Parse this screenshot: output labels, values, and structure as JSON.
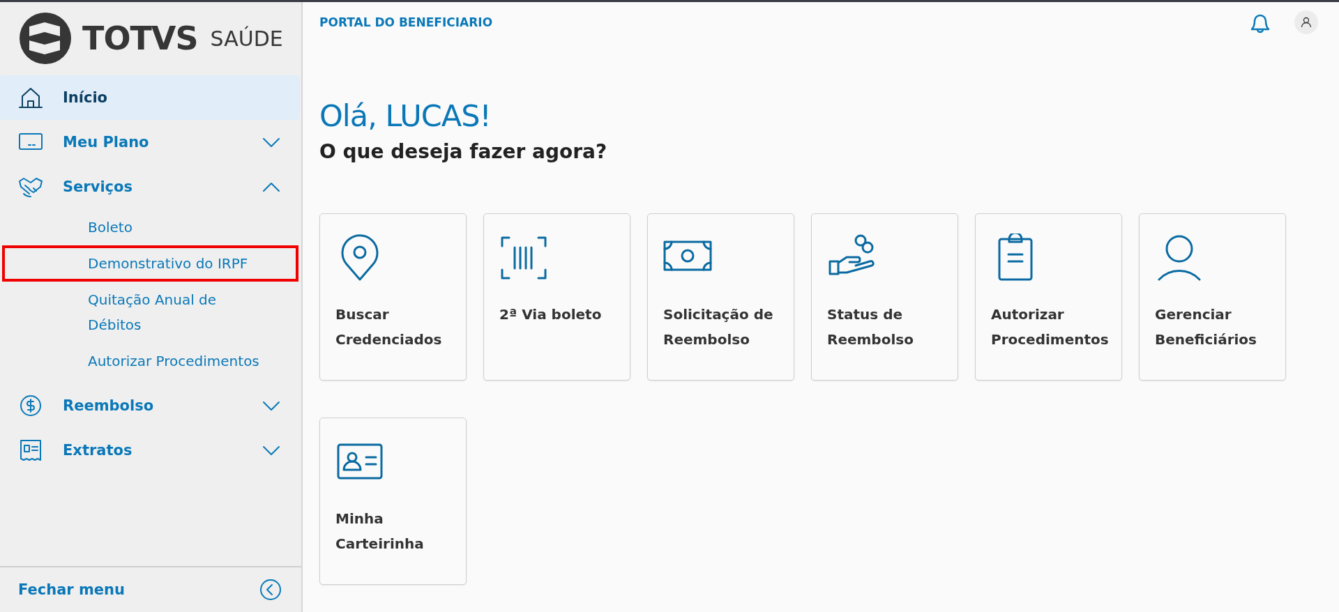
{
  "sidebar": {
    "logo": {
      "brand": "TOTVS",
      "product": "SAÚDE"
    },
    "items": [
      {
        "label": "Início",
        "selected": true
      },
      {
        "label": "Meu Plano",
        "expanded": false
      },
      {
        "label": "Serviços",
        "expanded": true,
        "children": [
          {
            "label": "Boleto",
            "highlighted": false
          },
          {
            "label": "Demonstrativo do IRPF",
            "highlighted": true
          },
          {
            "label": "Quitação Anual de Débitos",
            "highlighted": false
          },
          {
            "label": "Autorizar Procedimentos",
            "highlighted": false
          }
        ]
      },
      {
        "label": "Reembolso",
        "expanded": false
      },
      {
        "label": "Extratos",
        "expanded": false
      }
    ],
    "footer": "Fechar menu"
  },
  "header": {
    "title": "PORTAL DO BENEFICIARIO"
  },
  "greeting": "Olá, LUCAS!",
  "subtitle": "O que deseja fazer agora?",
  "cards": [
    {
      "label": "Buscar Credenciados"
    },
    {
      "label": "2ª Via boleto"
    },
    {
      "label": "Solicitação de Reembolso"
    },
    {
      "label": "Status de Reembolso"
    },
    {
      "label": "Autorizar Procedimentos"
    },
    {
      "label": "Gerenciar Beneficiários"
    },
    {
      "label": "Minha Carteirinha"
    }
  ]
}
